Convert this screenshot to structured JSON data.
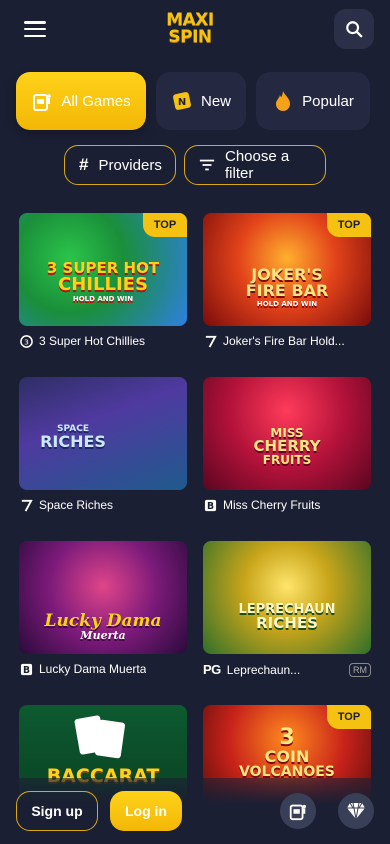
{
  "header": {
    "logo_line1": "MAXI",
    "logo_line2": "SPIN",
    "menu_icon": "hamburger-icon",
    "search_icon": "search-icon"
  },
  "categories": [
    {
      "label": "All Games",
      "icon": "slot-machine-icon",
      "active": true
    },
    {
      "label": "New",
      "icon": "new-badge-icon",
      "active": false
    },
    {
      "label": "Popular",
      "icon": "flame-icon",
      "active": false
    }
  ],
  "filters": {
    "providers_label": "Providers",
    "filter_label": "Choose a filter"
  },
  "games": [
    {
      "name": "3 Super Hot Chillies",
      "provider_icon": "3oaks-icon",
      "badge": "TOP",
      "art_lines": [
        "3 SUPER HOT",
        "CHILLIES"
      ],
      "art_sub": "HOLD AND WIN"
    },
    {
      "name": "Joker's Fire Bar Hold...",
      "provider_icon": "7-provider-icon",
      "badge": "TOP",
      "art_lines": [
        "JOKER'S",
        "FIRE BAR"
      ],
      "art_sub": "HOLD AND WIN"
    },
    {
      "name": "Space Riches",
      "provider_icon": "7-provider-icon",
      "badge": "",
      "art_lines": [
        "SPACE",
        "RICHES"
      ],
      "art_sub": ""
    },
    {
      "name": "Miss Cherry Fruits",
      "provider_icon": "b-provider-icon",
      "badge": "",
      "art_lines": [
        "MISS",
        "CHERRY",
        "FRUITS"
      ],
      "art_sub": ""
    },
    {
      "name": "Lucky Dama Muerta",
      "provider_icon": "b-provider-icon",
      "badge": "",
      "art_lines": [
        "Lucky Dama"
      ],
      "art_sub": "Muerta"
    },
    {
      "name": "Leprechaun...",
      "provider_icon": "pg-provider-icon",
      "provider_text": "PG",
      "rm": "RM",
      "badge": "",
      "art_lines": [
        "LEPRECHAUN",
        "RICHES"
      ],
      "art_sub": ""
    },
    {
      "name": "",
      "provider_icon": "",
      "badge": "",
      "art_lines": [
        "BACCARAT"
      ],
      "art_sub": ""
    },
    {
      "name": "",
      "provider_icon": "",
      "badge": "TOP",
      "art_lines": [
        "3",
        "COIN",
        "VOLCANOES"
      ],
      "art_sub": ""
    }
  ],
  "bottom_bar": {
    "signup_label": "Sign up",
    "login_label": "Log in",
    "slot_icon": "slot-machine-icon",
    "gem_icon": "diamond-icon"
  },
  "colors": {
    "background": "#1b1f33",
    "accent": "#f5c211",
    "surface": "#242841"
  }
}
